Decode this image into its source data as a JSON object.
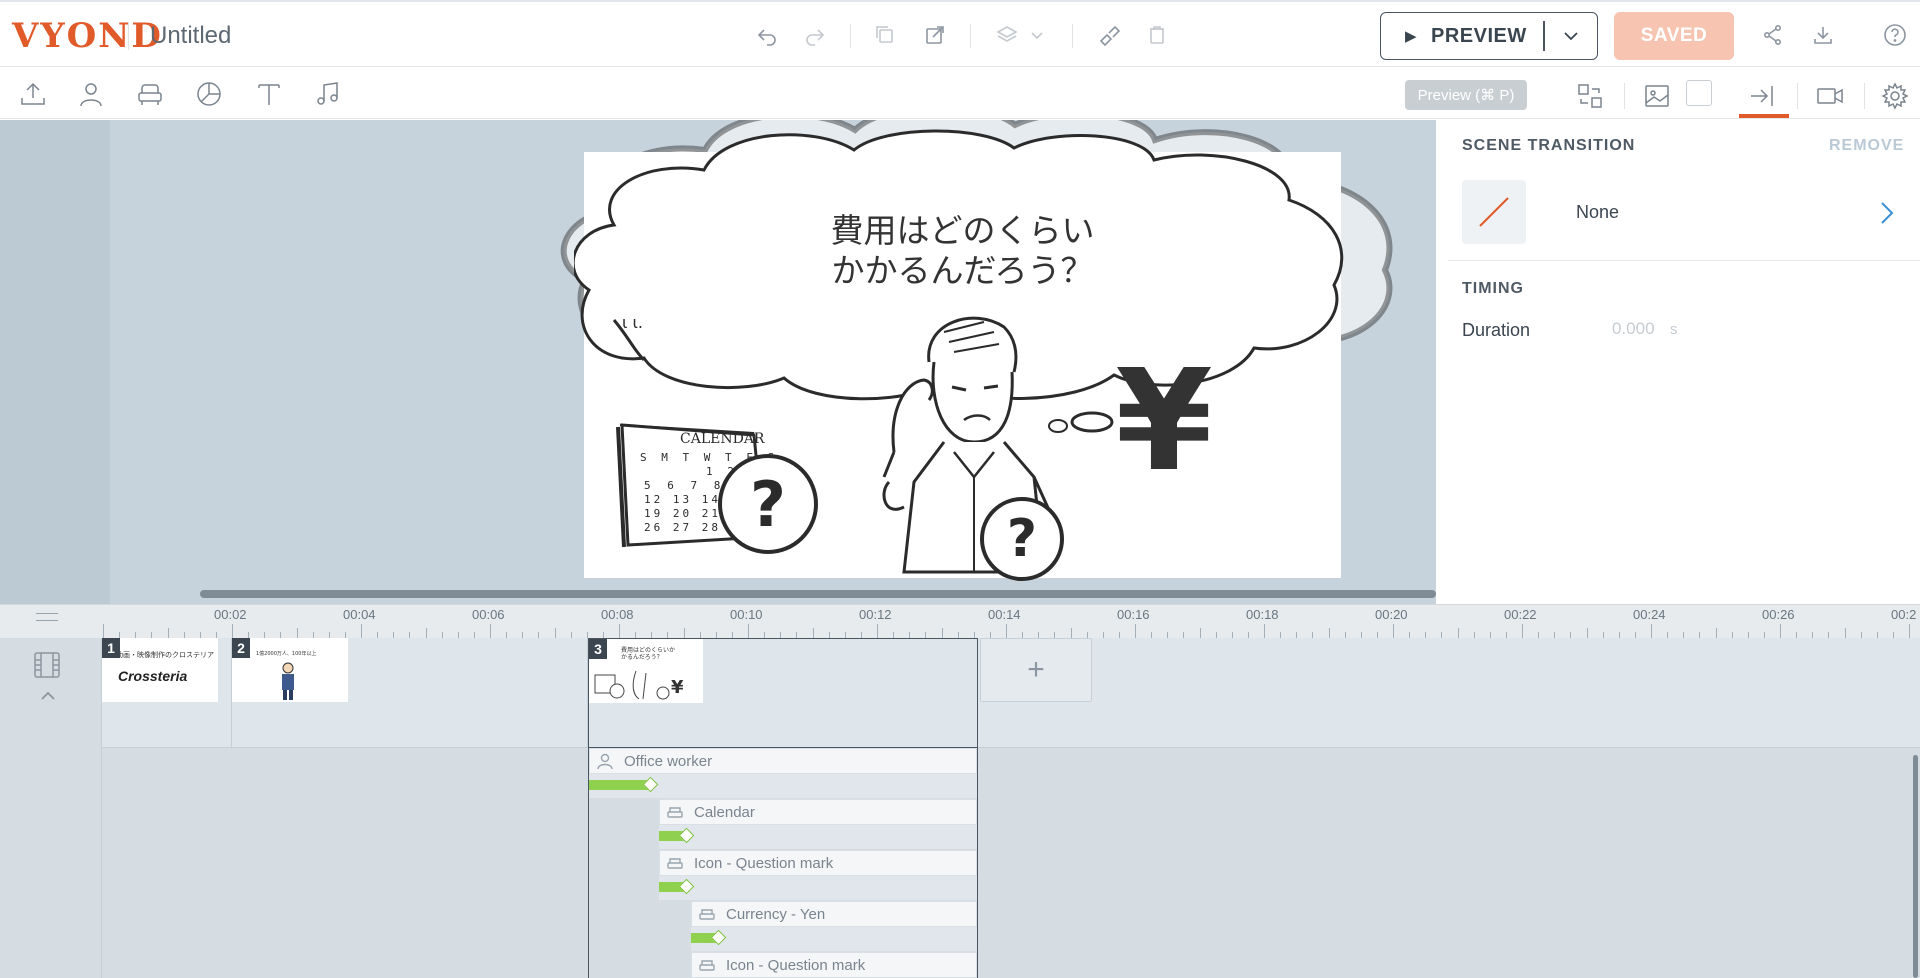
{
  "app": {
    "logo": "VYOND",
    "doc_title": "Untitled"
  },
  "header": {
    "preview_label": "PREVIEW",
    "saved_label": "SAVED",
    "preview_hint": "Preview (⌘ P)"
  },
  "canvas": {
    "bubble_line1": "費用はどのくらい",
    "bubble_line2": "かかるんだろう？",
    "calendar_label": "CALENDAR",
    "calendar_days": "S M T W T F S",
    "calendar_rows": [
      "1 2",
      "5 6 7 8",
      "12 13 14 15",
      "19 20 21",
      "26 27 28"
    ],
    "yen_symbol": "¥",
    "question_mark": "?"
  },
  "panel": {
    "scene_transition_title": "SCENE TRANSITION",
    "remove_label": "REMOVE",
    "transition_name": "None",
    "timing_title": "TIMING",
    "duration_label": "Duration",
    "duration_value": "0.000",
    "duration_unit": "s"
  },
  "timeline": {
    "ruler_labels": [
      "00:02",
      "00:04",
      "00:06",
      "00:08",
      "00:10",
      "00:12",
      "00:14",
      "00:16",
      "00:18",
      "00:20",
      "00:22",
      "00:24",
      "00:26",
      "00:2"
    ],
    "scenes": [
      {
        "number": "1",
        "caption": "動画・映像制作のクロステリア",
        "logo_text": "Crossteria"
      },
      {
        "number": "2",
        "caption": "1億2000万人、100年以上"
      },
      {
        "number": "3",
        "caption": "費用はどのくらいかかるんだろう？"
      }
    ],
    "add_scene_label": "+",
    "tracks": [
      {
        "name": "Office worker",
        "icon": "person-icon"
      },
      {
        "name": "Calendar",
        "icon": "prop-icon"
      },
      {
        "name": "Icon - Question mark",
        "icon": "prop-icon"
      },
      {
        "name": "Currency - Yen",
        "icon": "prop-icon"
      },
      {
        "name": "Icon - Question mark",
        "icon": "prop-icon"
      }
    ]
  },
  "colors": {
    "brand": "#e15a29",
    "saved_bg": "#f6c4b1",
    "track_green": "#8fd14f"
  }
}
